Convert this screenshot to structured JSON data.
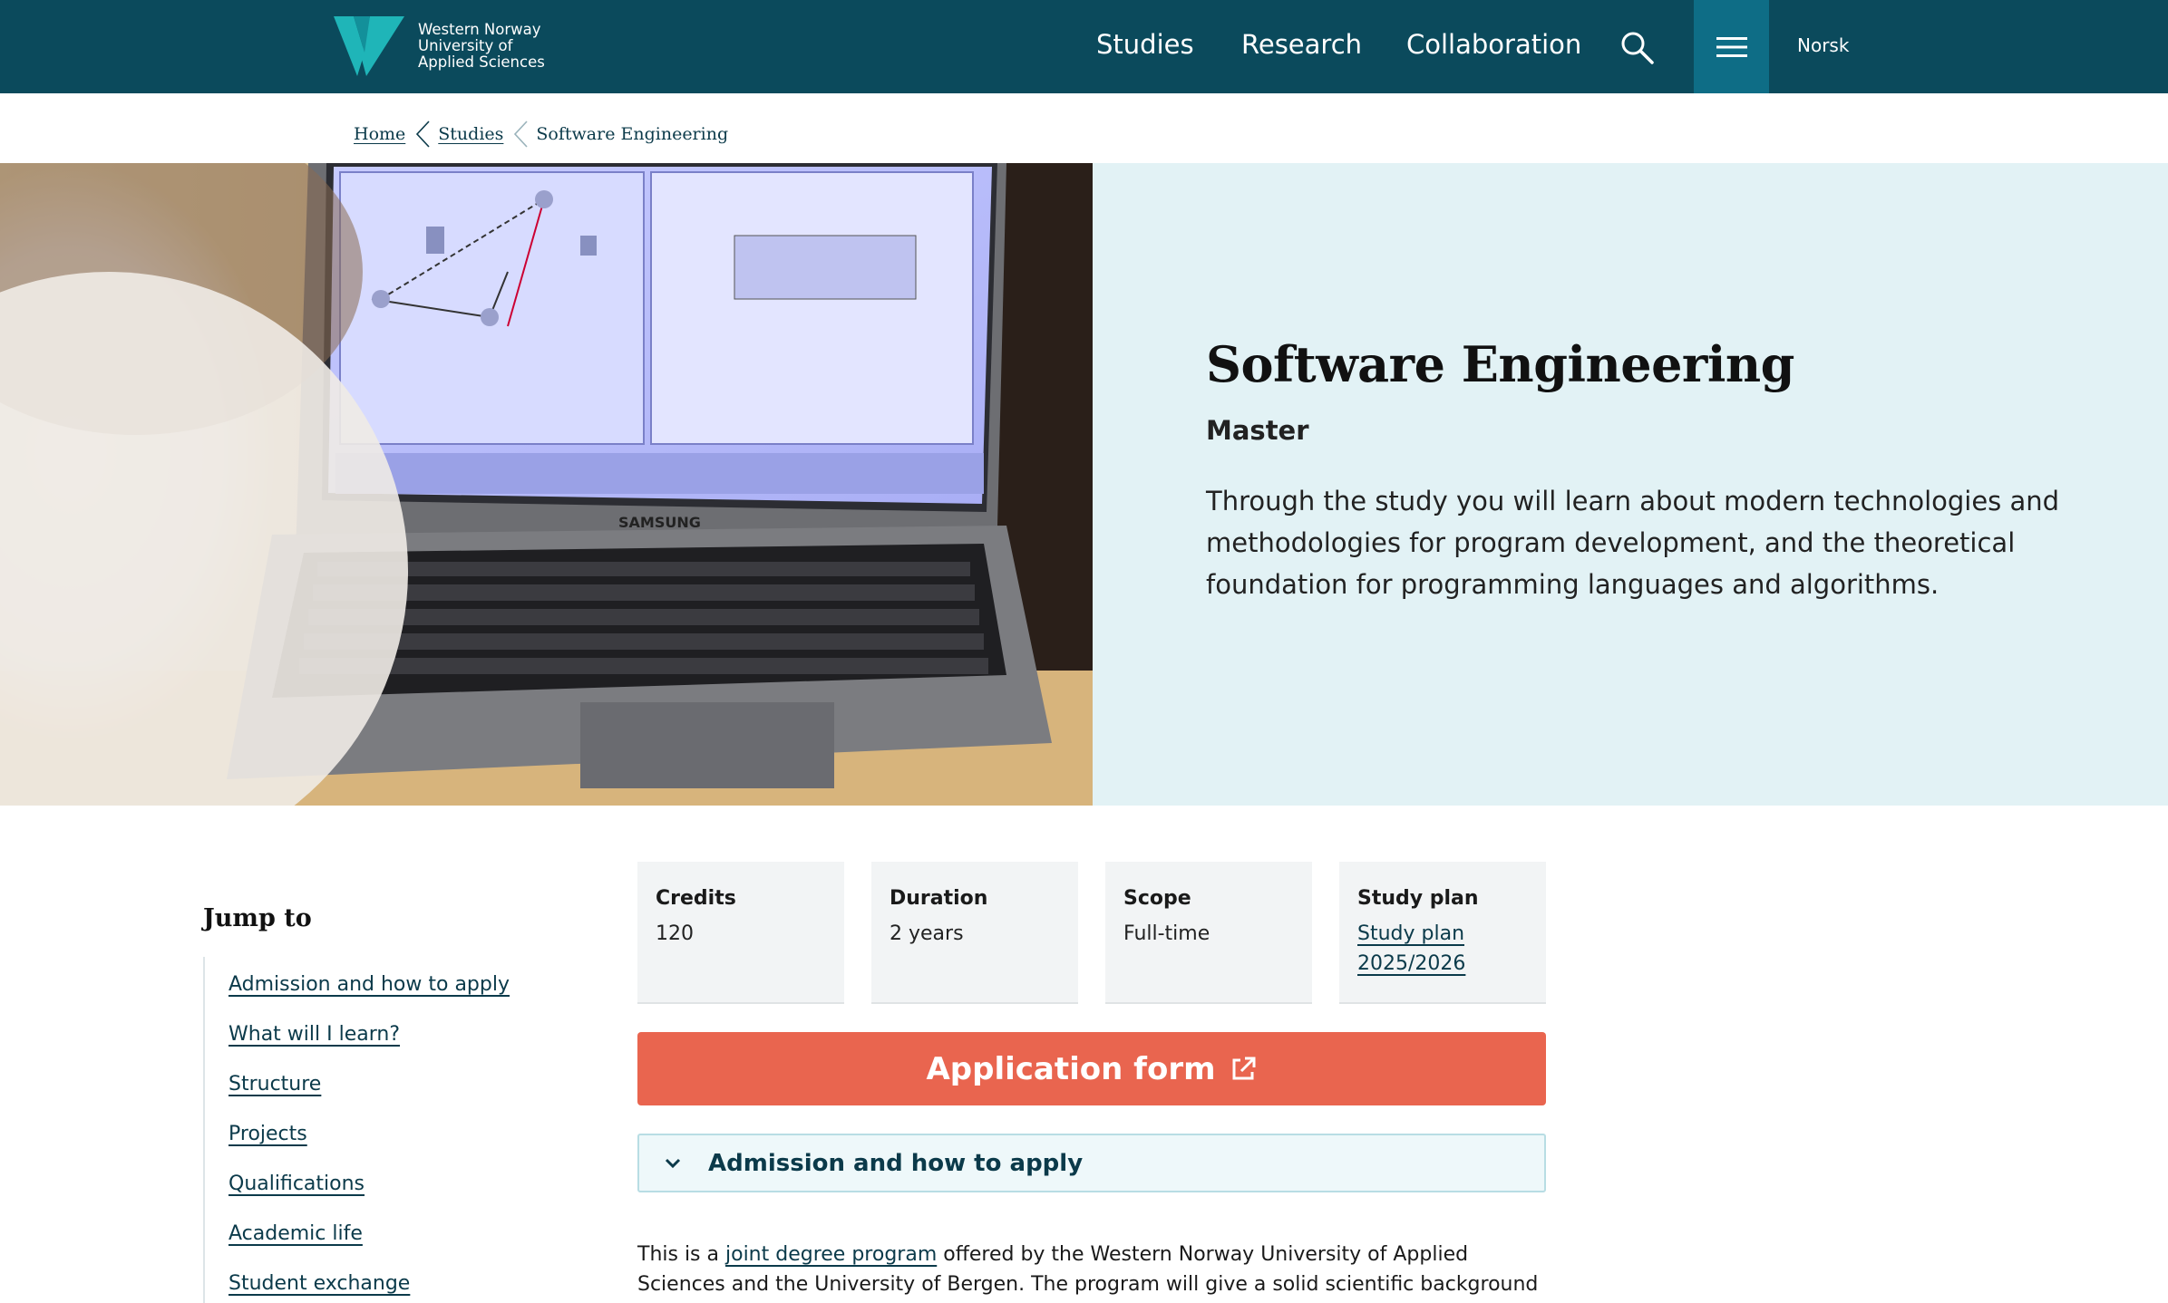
{
  "header": {
    "logo_lines": [
      "Western Norway",
      "University of",
      "Applied Sciences"
    ],
    "nav": [
      "Studies",
      "Research",
      "Collaboration"
    ],
    "language": "Norsk"
  },
  "breadcrumb": {
    "items": [
      "Home",
      "Studies",
      "Software Engineering"
    ]
  },
  "hero": {
    "title": "Software Engineering",
    "level": "Master",
    "description": "Through the study you will learn about modern technologies and methodologies for program development, and the theoretical foundation for programming languages and algorithms.",
    "image_laptop_brand": "SAMSUNG"
  },
  "jump_to": {
    "title": "Jump to",
    "links": [
      "Admission and how to apply",
      "What will I learn?",
      "Structure",
      "Projects",
      "Qualifications",
      "Academic life",
      "Student exchange"
    ]
  },
  "facts": [
    {
      "label": "Credits",
      "value": "120"
    },
    {
      "label": "Duration",
      "value": "2 years"
    },
    {
      "label": "Scope",
      "value": "Full-time"
    },
    {
      "label": "Study plan",
      "value": "Study plan 2025/2026"
    }
  ],
  "apply_button": "Application form",
  "accordion": {
    "label": "Admission and how to apply"
  },
  "body": {
    "prefix": "This is a ",
    "link": "joint degree program",
    "suffix": " offered by the Western Norway University of Applied Sciences and the University of Bergen. The program will give a solid scientific background"
  },
  "colors": {
    "header_bg": "#0b4a5c",
    "menu_bg": "#0e6d86",
    "accent_logo": "#1fb5b8",
    "hero_panel_bg": "#e2f2f5",
    "apply_button": "#e9654f",
    "link": "#0b3a4a"
  },
  "icons": [
    "logo-mark-icon",
    "search-icon",
    "hamburger-menu-icon",
    "chevron-left-icon",
    "external-link-icon",
    "chevron-down-icon"
  ]
}
